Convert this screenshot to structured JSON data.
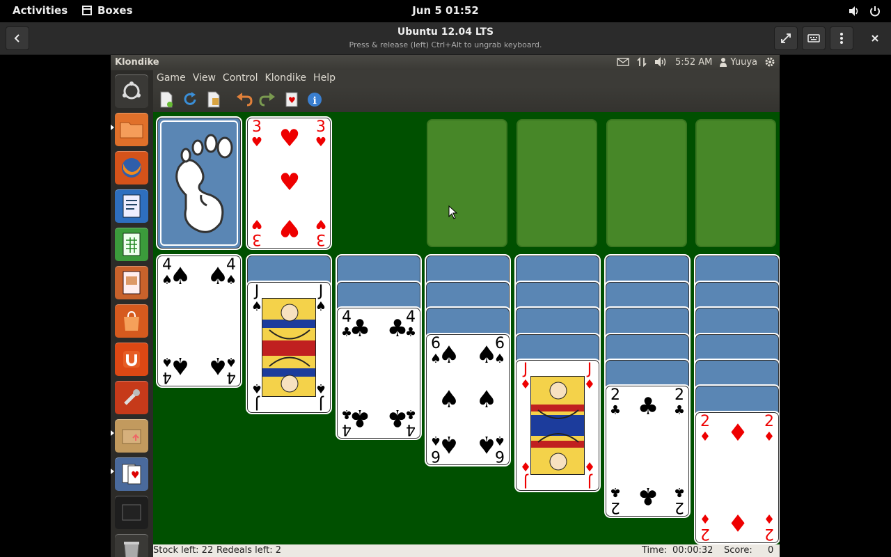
{
  "gnome": {
    "activities": "Activities",
    "app_name": "Boxes",
    "clock": "Jun 5  01:52"
  },
  "boxes": {
    "title": "Ubuntu 12.04 LTS",
    "subtitle": "Press & release (left) Ctrl+Alt to ungrab keyboard."
  },
  "unity": {
    "window_title": "Klondike",
    "time": "5:52 AM",
    "user": "Yuuya"
  },
  "menu": [
    "Game",
    "View",
    "Control",
    "Klondike",
    "Help"
  ],
  "status": {
    "stock": "Stock left: 22",
    "redeals": "Redeals left: 2",
    "time_label": "Time:",
    "time_value": "00:00:32",
    "score_label": "Score:",
    "score_value": "0"
  },
  "cards": {
    "waste": {
      "rank": "3",
      "suit": "♥"
    },
    "t1": {
      "rank": "4",
      "suit": "♠"
    },
    "t2": {
      "rank": "J",
      "suit": "♠"
    },
    "t3": {
      "rank": "4",
      "suit": "♣"
    },
    "t4": {
      "rank": "6",
      "suit": "♠"
    },
    "t5": {
      "rank": "J",
      "suit": "♦"
    },
    "t6": {
      "rank": "2",
      "suit": "♣"
    },
    "t7": {
      "rank": "2",
      "suit": "♦"
    }
  },
  "colors": {
    "felt": "#005000",
    "slot": "#4b8a2b",
    "card_back": "#5a86b4",
    "red_suit": "#e00000"
  }
}
